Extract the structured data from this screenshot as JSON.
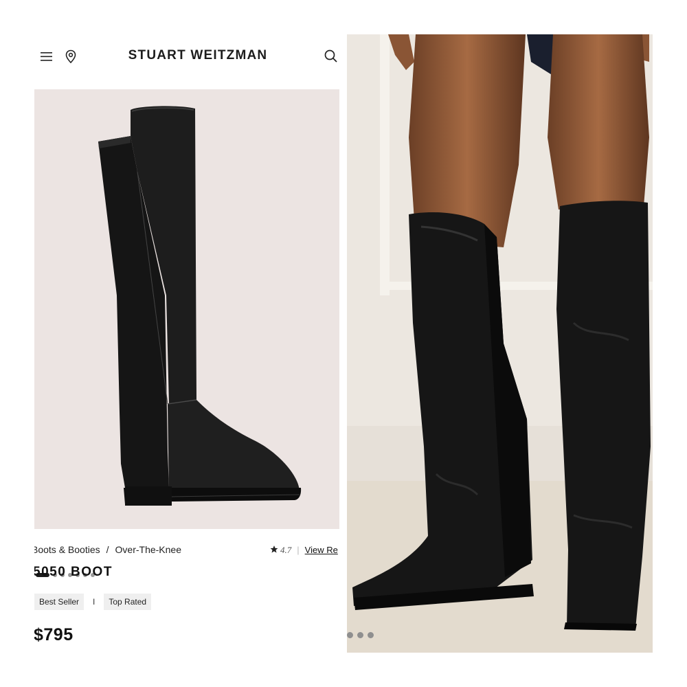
{
  "header": {
    "brand": "STUART WEITZMAN",
    "icons": [
      "menu-icon",
      "location-pin-icon",
      "search-icon"
    ]
  },
  "breadcrumb": {
    "level1": "Boots & Booties",
    "separator": "/",
    "level2": "Over-The-Knee"
  },
  "rating": {
    "value": "4.7",
    "link": "View Re"
  },
  "product": {
    "title": "5050 BOOT",
    "badges": [
      "Best Seller",
      "Top Rated"
    ],
    "badge_separator": "I",
    "price": "$795"
  },
  "carousel": {
    "total": 7,
    "active_index": 0
  },
  "lifestyle_carousel": {
    "dots_visible": 3
  },
  "colors": {
    "image_background": "#ece4e2",
    "boot_black": "#1b1b1b",
    "badge_background": "#efefef"
  }
}
